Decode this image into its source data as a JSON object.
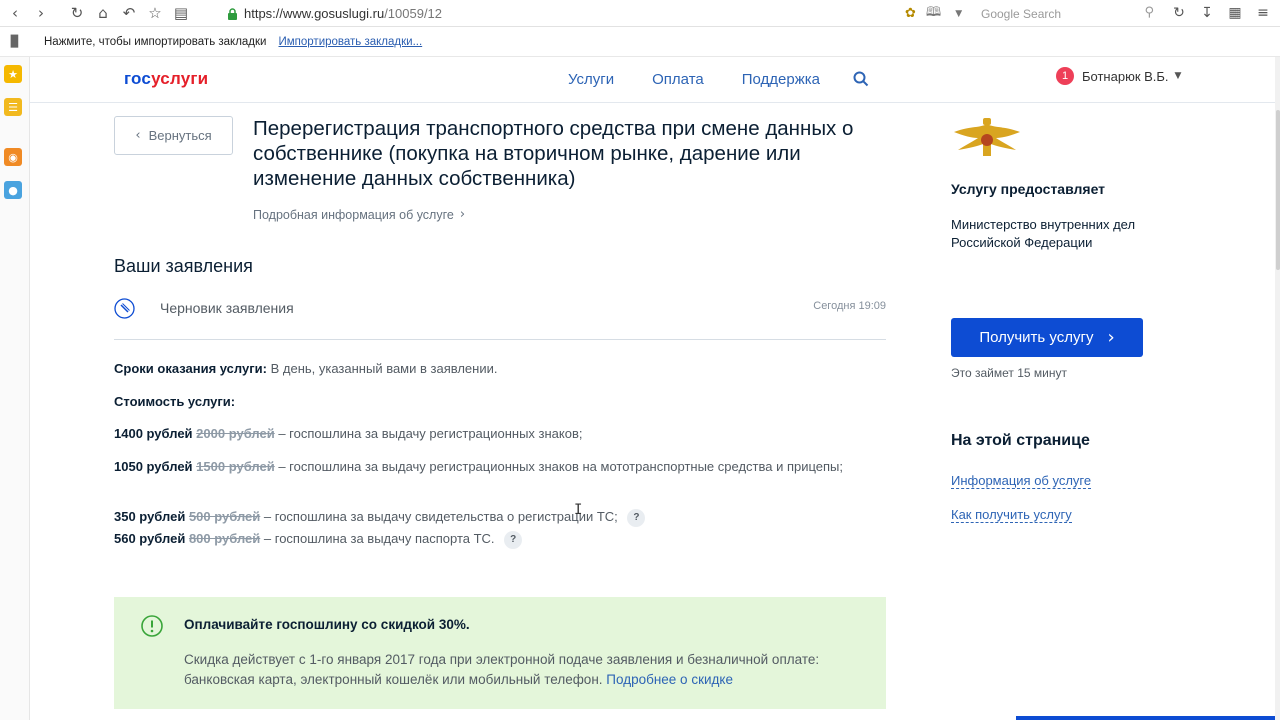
{
  "browser": {
    "url_host": "https://www.gosuslugi.ru",
    "url_path": "/10059/12",
    "search_placeholder": "Google Search"
  },
  "bookmarks_bar": {
    "prompt": "Нажмите, чтобы импортировать закладки",
    "import_link": "Импортировать закладки..."
  },
  "site": {
    "logo_part1": "гос",
    "logo_part2": "услуги",
    "nav": [
      "Услуги",
      "Оплата",
      "Поддержка"
    ],
    "notification_count": "1",
    "user_name": "Ботнарюк В.Б."
  },
  "main": {
    "back_label": "Вернуться",
    "title": "Перерегистрация транспортного средства при смене данных о собственнике (покупка на вторичном рынке, дарение или изменение данных собственника)",
    "more_info": "Подробная информация об услуге",
    "applications_title": "Ваши заявления",
    "draft_label": "Черновик заявления",
    "draft_time": "Сегодня 19:09",
    "terms_label": "Сроки оказания услуги:",
    "terms_value": "В день, указанный вами в заявлении.",
    "cost_label": "Стоимость услуги:",
    "fees": [
      {
        "price": "1400 рублей",
        "old": "2000 рублей",
        "desc": "– госпошлина за выдачу регистрационных знаков;"
      },
      {
        "price": "1050 рублей",
        "old": "1500 рублей",
        "desc": "– госпошлина за выдачу регистрационных знаков на мототранспортные средства и прицепы;"
      },
      {
        "price": "350 рублей",
        "old": "500 рублей",
        "desc": "– госпошлина за выдачу свидетельства о регистрации ТС;"
      },
      {
        "price": "560 рублей",
        "old": "800 рублей",
        "desc": "– госпошлина за выдачу паспорта ТС."
      }
    ],
    "help_mark": "?",
    "discount_title": "Оплачивайте госпошлину со скидкой 30%.",
    "discount_text": "Скидка действует с 1-го января 2017 года при электронной подаче заявления и безналичной оплате: банковская карта, электронный кошелёк или мобильный телефон.",
    "discount_link": "Подробнее о скидке"
  },
  "aside": {
    "provider_heading": "Услугу предоставляет",
    "provider_name": "Министерство внутренних дел Российской Федерации",
    "get_service": "Получить услугу",
    "duration": "Это займет 15 минут",
    "onpage_heading": "На этой странице",
    "onpage_links": [
      "Информация об услуге",
      "Как получить услугу"
    ]
  },
  "colors": {
    "brand_blue": "#0d4cd3",
    "brand_red": "#e5202a",
    "discount_bg": "#e4f6da",
    "badge_red": "#ee3f58"
  }
}
